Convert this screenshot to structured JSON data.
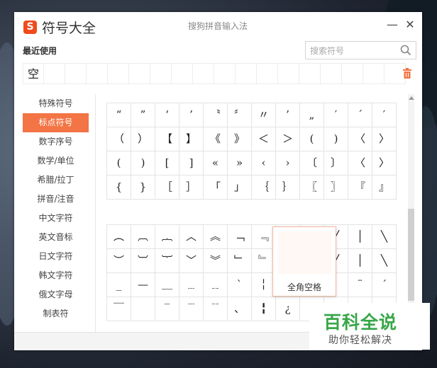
{
  "window": {
    "logo_letter": "S",
    "title": "符号大全",
    "subtitle": "搜狗拼音输入法",
    "minimize_glyph": "—",
    "close_glyph": "✕"
  },
  "recent": {
    "label": "最近使用",
    "cells": [
      "空",
      "",
      "",
      "",
      "",
      "",
      "",
      "",
      "",
      "",
      "",
      "",
      "",
      "",
      "",
      "",
      "",
      ""
    ]
  },
  "search": {
    "placeholder": "搜索符号",
    "value": ""
  },
  "sidebar": {
    "items": [
      {
        "label": "特殊符号"
      },
      {
        "label": "标点符号",
        "active": true
      },
      {
        "label": "数字序号"
      },
      {
        "label": "数学/单位"
      },
      {
        "label": "希腊/拉丁"
      },
      {
        "label": "拼音/注音"
      },
      {
        "label": "中文字符"
      },
      {
        "label": "英文音标"
      },
      {
        "label": "日文字符"
      },
      {
        "label": "韩文字符"
      },
      {
        "label": "俄文字母"
      },
      {
        "label": "制表符"
      }
    ]
  },
  "punct_grid": [
    [
      "“",
      "”",
      "‘",
      "’",
      "〝",
      "〞",
      "〃",
      "’",
      "„",
      "′",
      "´",
      "′"
    ],
    [
      "（",
      "）",
      "【",
      "】",
      "《",
      "》",
      "＜",
      "＞",
      "(",
      ")",
      "〈",
      "〉"
    ],
    [
      "(",
      ")",
      "[",
      "]",
      "«",
      "»",
      "‹",
      "›",
      "〔",
      "〕",
      "〈",
      "〉"
    ],
    [
      "{",
      "}",
      "［",
      "］",
      "「",
      "」",
      "｛",
      "｝",
      "〖",
      "〗",
      "『",
      "』"
    ]
  ],
  "shape_grid": [
    [
      "︵",
      "︹",
      "︷",
      "︿",
      "︽",
      "﹁",
      "﹃",
      "",
      "",
      "╱",
      "│",
      "╲"
    ],
    [
      "︶",
      "︺",
      "︸",
      "﹀",
      "︾",
      "﹂",
      "﹄",
      "",
      "",
      "╱",
      "│",
      "╲"
    ],
    [
      "_",
      "—",
      "＿",
      "﹍",
      "﹎",
      "ˋ",
      "╎",
      "",
      "",
      "",
      "¨",
      "ˊ"
    ],
    [
      "￣",
      "",
      "‾",
      "﹉",
      "﹊",
      "、",
      "╏",
      "¿",
      "",
      "",
      "",
      ""
    ]
  ],
  "tooltip": {
    "label": "全角空格"
  },
  "watermark": {
    "title": "百科全说",
    "caption": "助你轻松解决"
  },
  "colors": {
    "accent": "#f37444",
    "logo": "#f04b1c",
    "watermark_green": "#37a648"
  }
}
